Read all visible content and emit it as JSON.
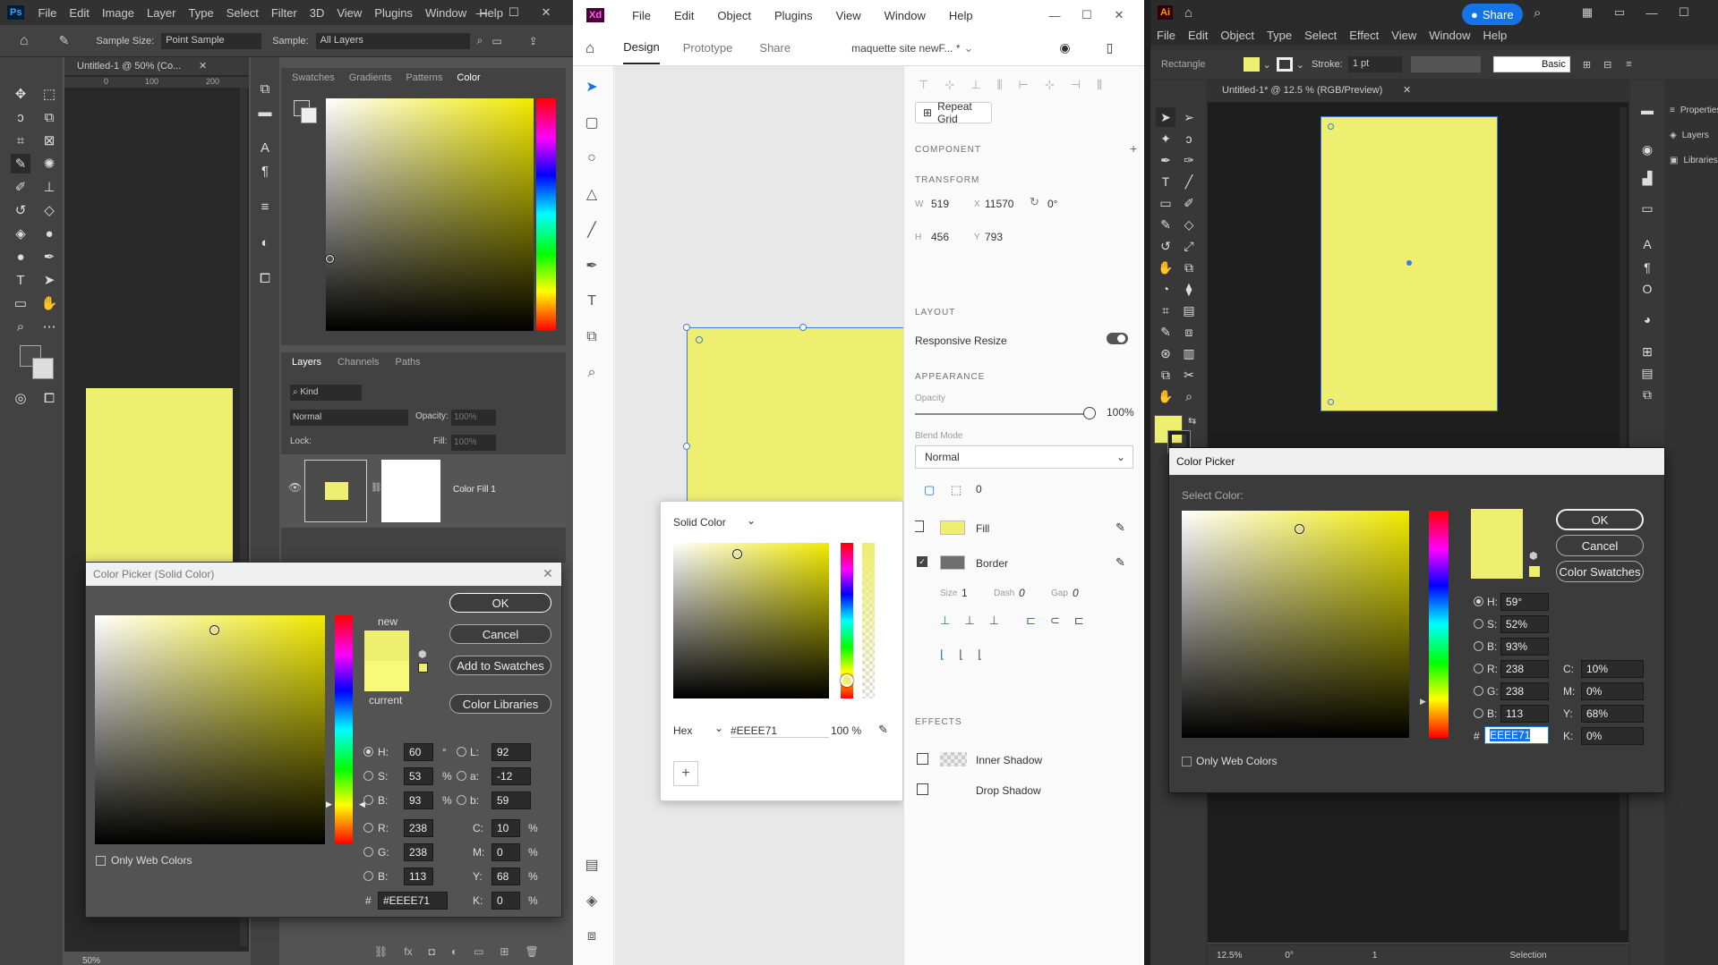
{
  "photoshop": {
    "menu": [
      "File",
      "Edit",
      "Image",
      "Layer",
      "Type",
      "Select",
      "Filter",
      "3D",
      "View",
      "Plugins",
      "Window",
      "Help"
    ],
    "options": {
      "sample_size_label": "Sample Size:",
      "sample_size_value": "Point Sample",
      "sample_label": "Sample:",
      "sample_value": "All Layers"
    },
    "doc_tab": "Untitled-1 @ 50% (Co...",
    "ruler": [
      "0",
      "100",
      "200"
    ],
    "color_panel_tabs": [
      "Swatches",
      "Gradients",
      "Patterns",
      "Color"
    ],
    "layers_tabs": [
      "Layers",
      "Channels",
      "Paths"
    ],
    "layers": {
      "kind": "Kind",
      "blend": "Normal",
      "opacity_label": "Opacity:",
      "opacity": "100%",
      "lock_label": "Lock:",
      "fill_label": "Fill:",
      "fill": "100%",
      "layer_name": "Color Fill 1"
    },
    "zoom": "50%",
    "picker": {
      "title": "Color Picker (Solid Color)",
      "new_label": "new",
      "current_label": "current",
      "ok": "OK",
      "cancel": "Cancel",
      "add_swatches": "Add to Swatches",
      "color_libraries": "Color Libraries",
      "only_web": "Only Web Colors",
      "H": "60",
      "S": "53",
      "B": "93",
      "R": "238",
      "G": "238",
      "Bb": "113",
      "L": "92",
      "a": "-12",
      "b": "59",
      "C": "10",
      "M": "0",
      "Y": "68",
      "K": "0",
      "hex": "#EEEE71",
      "deg": "°",
      "pct": "%",
      "hash": "#"
    },
    "color": "#EEEE71"
  },
  "xd": {
    "menu": [
      "File",
      "Edit",
      "Object",
      "Plugins",
      "View",
      "Window",
      "Help"
    ],
    "tabs": [
      "Design",
      "Prototype",
      "Share"
    ],
    "doc": "maquette site newF... *",
    "repeat_grid": "Repeat Grid",
    "component": "COMPONENT",
    "transform": "TRANSFORM",
    "W_label": "W",
    "W": "519",
    "X_label": "X",
    "X": "11570",
    "rot": "0°",
    "H_label": "H",
    "H": "456",
    "Y_label": "Y",
    "Y": "793",
    "layout": "LAYOUT",
    "responsive": "Responsive Resize",
    "appearance": "APPEARANCE",
    "opacity_label": "Opacity",
    "opacity": "100%",
    "blend_label": "Blend Mode",
    "blend": "Normal",
    "corner": "0",
    "fill": "Fill",
    "border": "Border",
    "size_label": "Size",
    "size": "1",
    "dash_label": "Dash",
    "dash": "0",
    "gap_label": "Gap",
    "gap": "0",
    "effects": "EFFECTS",
    "inner_shadow": "Inner Shadow",
    "drop_shadow": "Drop Shadow",
    "popup": {
      "mode": "Solid Color",
      "format": "Hex",
      "hex": "#EEEE71",
      "alpha": "100 %"
    }
  },
  "illustrator": {
    "menu": [
      "File",
      "Edit",
      "Object",
      "Type",
      "Select",
      "Effect",
      "View",
      "Window",
      "Help"
    ],
    "share": "Share",
    "control": {
      "object": "Rectangle",
      "stroke_label": "Stroke:",
      "stroke": "1 pt",
      "profile": "Basic"
    },
    "doc_tab": "Untitled-1* @ 12.5 % (RGB/Preview)",
    "panels": [
      "Properties",
      "Layers",
      "Libraries"
    ],
    "status": {
      "zoom": "12.5%",
      "rotate": "0°",
      "artboard": "1",
      "mode": "Selection"
    },
    "picker": {
      "title": "Color Picker",
      "select": "Select Color:",
      "ok": "OK",
      "cancel": "Cancel",
      "swatches": "Color Swatches",
      "only_web": "Only Web Colors",
      "H": "59°",
      "S": "52%",
      "B": "93%",
      "R": "238",
      "G": "238",
      "Bb": "113",
      "C": "10%",
      "M": "0%",
      "Y": "68%",
      "K": "0%",
      "hex": "EEEE71"
    }
  }
}
